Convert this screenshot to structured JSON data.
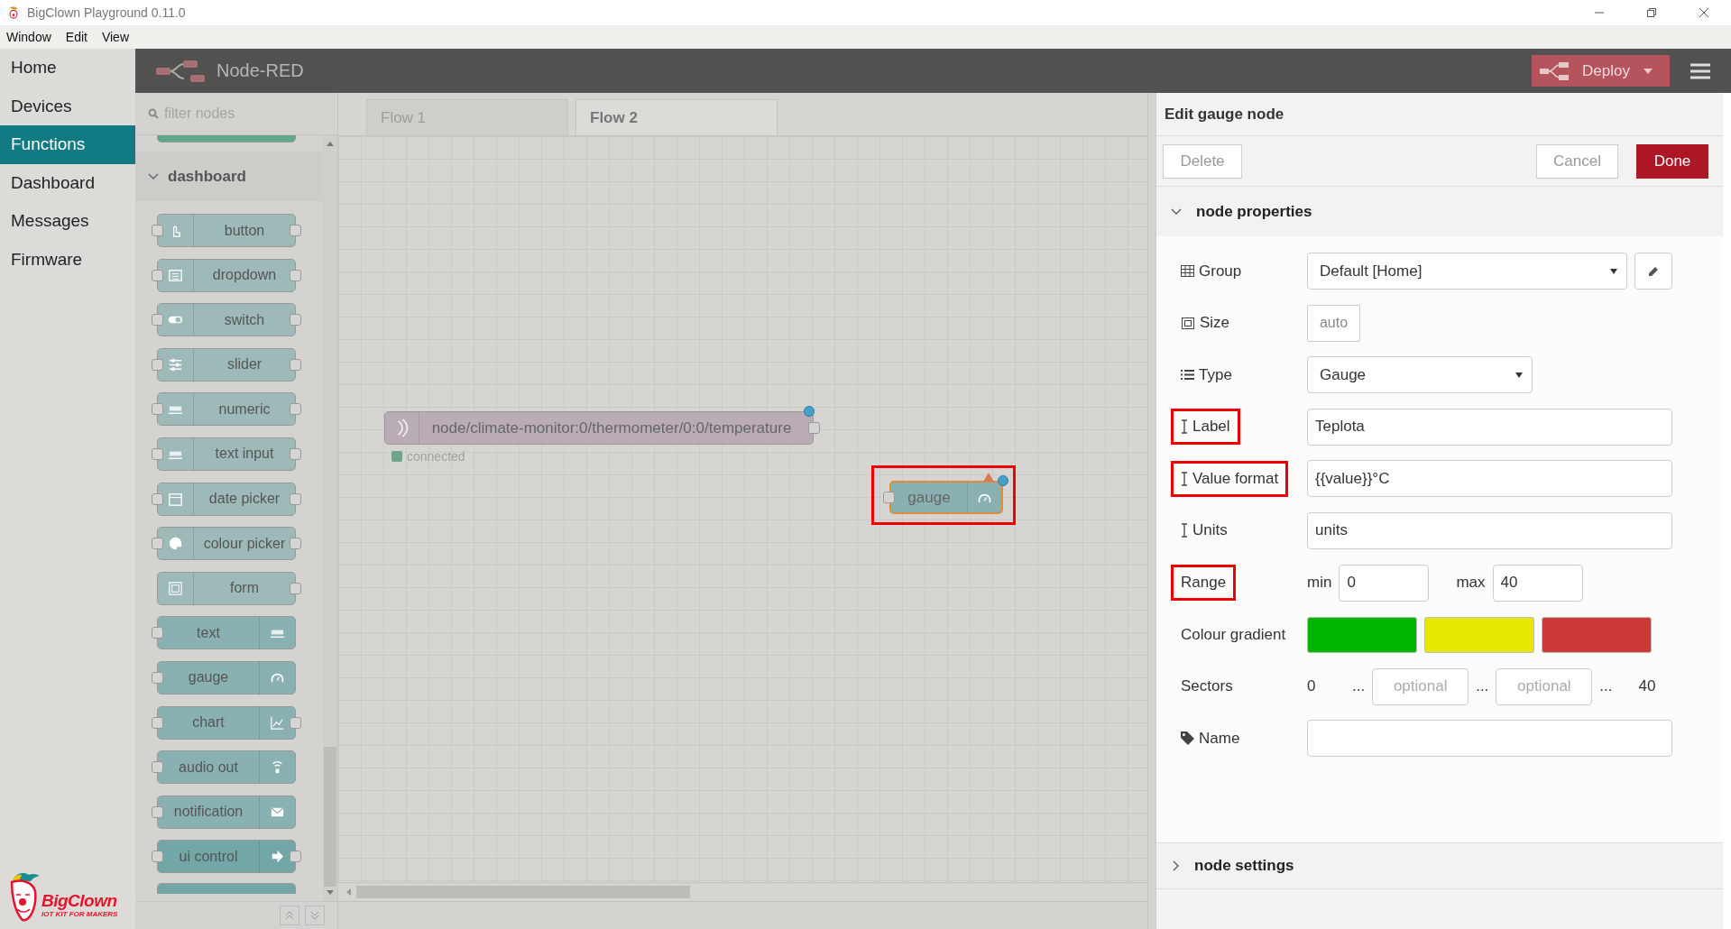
{
  "window": {
    "title": "BigClown Playground 0.11.0"
  },
  "menu": [
    "Window",
    "Edit",
    "View"
  ],
  "nav": [
    {
      "label": "Home",
      "selected": false
    },
    {
      "label": "Devices",
      "selected": false
    },
    {
      "label": "Functions",
      "selected": true
    },
    {
      "label": "Dashboard",
      "selected": false
    },
    {
      "label": "Messages",
      "selected": false
    },
    {
      "label": "Firmware",
      "selected": false
    }
  ],
  "logo": {
    "name": "BigClown",
    "tagline": "IOT KIT FOR MAKERS"
  },
  "header": {
    "title": "Node-RED",
    "deploy": "Deploy"
  },
  "palette": {
    "filter_placeholder": "filter nodes",
    "category": {
      "label": "dashboard",
      "expanded": true
    },
    "nodes": [
      {
        "label": "button",
        "kind": "input",
        "has_input": true,
        "has_output": true
      },
      {
        "label": "dropdown",
        "kind": "input",
        "has_input": true,
        "has_output": true
      },
      {
        "label": "switch",
        "kind": "input",
        "has_input": true,
        "has_output": true
      },
      {
        "label": "slider",
        "kind": "input",
        "has_input": true,
        "has_output": true
      },
      {
        "label": "numeric",
        "kind": "input",
        "has_input": true,
        "has_output": true
      },
      {
        "label": "text input",
        "kind": "input",
        "has_input": true,
        "has_output": true
      },
      {
        "label": "date picker",
        "kind": "input",
        "has_input": true,
        "has_output": true
      },
      {
        "label": "colour picker",
        "kind": "input",
        "has_input": true,
        "has_output": true
      },
      {
        "label": "form",
        "kind": "input",
        "has_input": false,
        "has_output": true
      },
      {
        "label": "text",
        "kind": "output",
        "has_input": true,
        "has_output": false
      },
      {
        "label": "gauge",
        "kind": "output",
        "has_input": true,
        "has_output": false
      },
      {
        "label": "chart",
        "kind": "output",
        "has_input": true,
        "has_output": true
      },
      {
        "label": "audio out",
        "kind": "output",
        "has_input": true,
        "has_output": false
      },
      {
        "label": "notification",
        "kind": "output",
        "has_input": true,
        "has_output": false
      },
      {
        "label": "ui control",
        "kind": "control",
        "has_input": true,
        "has_output": true
      }
    ]
  },
  "workspace": {
    "tabs": [
      {
        "label": "Flow 1",
        "selected": false
      },
      {
        "label": "Flow 2",
        "selected": true
      }
    ],
    "nodes": [
      {
        "kind": "mqtt",
        "label": "node/climate-monitor:0/thermometer/0:0/temperature",
        "status": "connected",
        "changed": true,
        "warning": false,
        "highlighted": false
      },
      {
        "kind": "gauge",
        "label": "gauge",
        "changed": true,
        "warning": true,
        "highlighted": true
      }
    ]
  },
  "editor": {
    "title": "Edit gauge node",
    "delete": "Delete",
    "cancel": "Cancel",
    "done": "Done",
    "properties": {
      "label": "node properties",
      "expanded": true
    },
    "settings": {
      "label": "node settings",
      "expanded": false
    },
    "rows": [
      {
        "kind": "select",
        "label": "Group",
        "value": "Default [Home]",
        "editable": true,
        "highlighted": false
      },
      {
        "kind": "size",
        "label": "Size",
        "value": "auto",
        "highlighted": false
      },
      {
        "kind": "select",
        "label": "Type",
        "value": "Gauge",
        "editable": false,
        "highlighted": false
      },
      {
        "kind": "text",
        "label": "Label",
        "value": "Teplota",
        "highlighted": true
      },
      {
        "kind": "text",
        "label": "Value format",
        "value": "{{value}}°C",
        "highlighted": true
      },
      {
        "kind": "text",
        "label": "Units",
        "value": "units",
        "highlighted": false
      },
      {
        "kind": "range",
        "label": "Range",
        "min_label": "min",
        "min": "0",
        "max_label": "max",
        "max": "40",
        "highlighted": true
      },
      {
        "kind": "gradient",
        "label": "Colour gradient",
        "colors": [
          {
            "color": "#00b500"
          },
          {
            "color": "#e6e600"
          },
          {
            "color": "#ca3838"
          }
        ],
        "highlighted": false
      },
      {
        "kind": "sectors",
        "label": "Sectors",
        "start": "0",
        "separators": [
          "...",
          "...",
          "..."
        ],
        "fields": [
          {
            "placeholder": "optional"
          },
          {
            "placeholder": "optional"
          }
        ],
        "end": "40",
        "highlighted": false
      },
      {
        "kind": "text",
        "label": "Name",
        "highlighted": false
      }
    ]
  }
}
